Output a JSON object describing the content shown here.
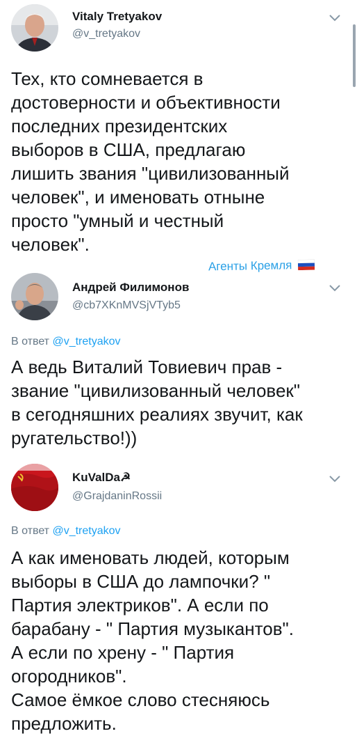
{
  "tweets": [
    {
      "name": "Vitaly Tretyakov",
      "handle": "@v_tretyakov",
      "text": "Тех, кто сомневается в\nдостоверности и объективности\nпоследних президентских\nвыборов в США, предлагаю\nлишить звания \"цивилизованный\nчеловек\", и именовать отныне\nпросто \"умный и честный\nчеловек\"."
    },
    {
      "name": "Андрей Филимонов",
      "handle": "@cb7XKnMVSjVTyb5",
      "reply_prefix": "В ответ",
      "reply_to": "@v_tretyakov",
      "text": "А ведь Виталий Товиевич прав -\nзвание \"цивилизованный человек\"\nв сегодняшних реалиях звучит, как\nругательство!))"
    },
    {
      "name": "KuValDa☭",
      "handle": "@GrajdaninRossii",
      "reply_prefix": "В ответ",
      "reply_to": "@v_tretyakov",
      "text": "А как именовать людей, которым\nвыборы в США до лампочки? \"\nПартия электриков\". А если по\nбарабану - \" Партия музыкантов\".\nА если по хрену - \" Партия\nогородников\".\nСамое ёмкое слово стесняюсь\nпредложить."
    }
  ],
  "watermark": "Агенты Кремля",
  "icons": {
    "chevron": "chevron-down-icon",
    "flag": "russian-flag-icon"
  },
  "colors": {
    "link": "#1da1f2",
    "secondary": "#657786",
    "watermark": "#2aa0e6"
  }
}
